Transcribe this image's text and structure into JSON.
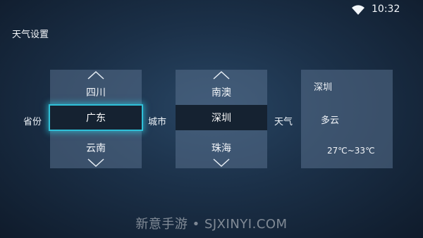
{
  "status_bar": {
    "time": "10:32",
    "wifi_icon": "wifi-icon"
  },
  "page": {
    "title": "天气设置"
  },
  "labels": {
    "province": "省份",
    "city": "城市",
    "weather": "天气"
  },
  "province_picker": {
    "prev": "四川",
    "selected": "广东",
    "next": "云南",
    "up_icon": "chevron-up-icon",
    "down_icon": "chevron-down-icon"
  },
  "city_picker": {
    "prev": "南澳",
    "selected": "深圳",
    "next": "珠海",
    "up_icon": "chevron-up-icon",
    "down_icon": "chevron-down-icon"
  },
  "weather_card": {
    "city": "深圳",
    "condition": "多云",
    "temperature": "27℃~33℃"
  },
  "watermark": "新意手游 • SJXINYI.COM",
  "colors": {
    "focus_border": "#2fc0d8",
    "selected_bg": "#152231",
    "panel_bg": "#58708c"
  }
}
